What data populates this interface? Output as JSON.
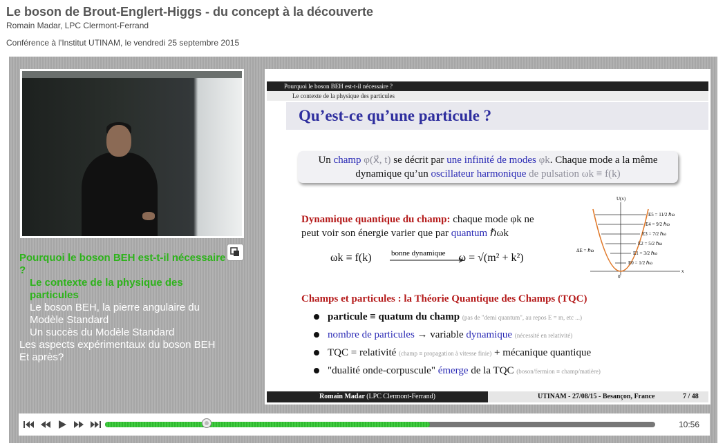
{
  "header": {
    "title": "Le boson de Brout-Englert-Higgs - du concept à la découverte",
    "author": "Romain Madar, LPC Clermont-Ferrand",
    "conference": "Conférence à l'Institut UTINAM, le vendredi 25 septembre 2015"
  },
  "toc": [
    {
      "label": "Pourquoi le boson BEH est-t-il nécessaire ?",
      "level": 1,
      "active": true
    },
    {
      "label": "Le contexte de la physique des particules",
      "level": 2,
      "active": true
    },
    {
      "label": "Le boson BEH, la pierre angulaire du Modèle Standard",
      "level": 2,
      "active": false
    },
    {
      "label": "Un succès du Modèle Standard",
      "level": 2,
      "active": false
    },
    {
      "label": "Les aspects expérimentaux du boson BEH",
      "level": 1,
      "active": false
    },
    {
      "label": "Et après?",
      "level": 1,
      "active": false
    }
  ],
  "slide": {
    "section": "Pourquoi le boson BEH est-t-il nécessaire ?",
    "subsection": "Le contexte de la physique des particules",
    "title": "Qu’est-ce qu’une particule ?",
    "box": {
      "p1": "Un",
      "champ": "champ",
      "phi": "φ(x⃗, t)",
      "p2": "se décrit par",
      "modes": "une infinité de modes",
      "phik": "φk",
      "p3": ". Chaque mode a la même dynamique qu’un",
      "osc": "oscillateur harmonique",
      "puls": "de pulsation ωk ≡ f(k)"
    },
    "dyn": {
      "label": "Dynamique quantique du champ:",
      "text1": "chaque mode φk ne peut voir son énergie varier que par",
      "quantum": "quantum",
      "hbar": "ℏωk"
    },
    "eq": {
      "left": "ωk ≡ f(k)",
      "arrow_label": "bonne dynamique",
      "right": "ω = √(m² + k²)"
    },
    "diagram": {
      "axis_y": "U(x)",
      "axis_x": "x",
      "origin": "0",
      "delta": "ΔE = ℏω",
      "levels": [
        "E5 = 11/2 ℏω",
        "E4 = 9/2 ℏω",
        "E3 = 7/2 ℏω",
        "E2 = 5/2 ℏω",
        "E1 = 3/2 ℏω",
        "E0 = 1/2 ℏω"
      ]
    },
    "champs_title": "Champs et particules : la Théorie Quantique des Champs (TQC)",
    "bullets": [
      {
        "main": "particule ≡ quatum du champ",
        "note": "(pas de \"demi quantum\", au repos E = m, etc ...)"
      },
      {
        "main_blue": "nombre de particules",
        "mid": "→ variable",
        "blue2": "dynamique",
        "note": "(nécessité en relativité)"
      },
      {
        "main": "TQC = relativité",
        "note": "(champ ≡ propagation à vitesse finie)",
        "tail": "+ mécanique quantique"
      },
      {
        "main": "\"dualité onde-corpuscule\"",
        "blue2": "émerge",
        "tail": "de la TQC",
        "note": "(boson/fermion ≡ champ/matière)"
      }
    ],
    "footer": {
      "author": "Romain Madar",
      "affil": "(LPC Clermont-Ferrand)",
      "event": "UTINAM - 27/08/15 - Besançon, France",
      "page": "7 / 48"
    }
  },
  "player": {
    "time": "10:56",
    "progress": 0.59,
    "position": 0.185,
    "icons": [
      "skip-start-icon",
      "rewind-icon",
      "play-icon",
      "fast-forward-icon",
      "skip-end-icon"
    ]
  }
}
